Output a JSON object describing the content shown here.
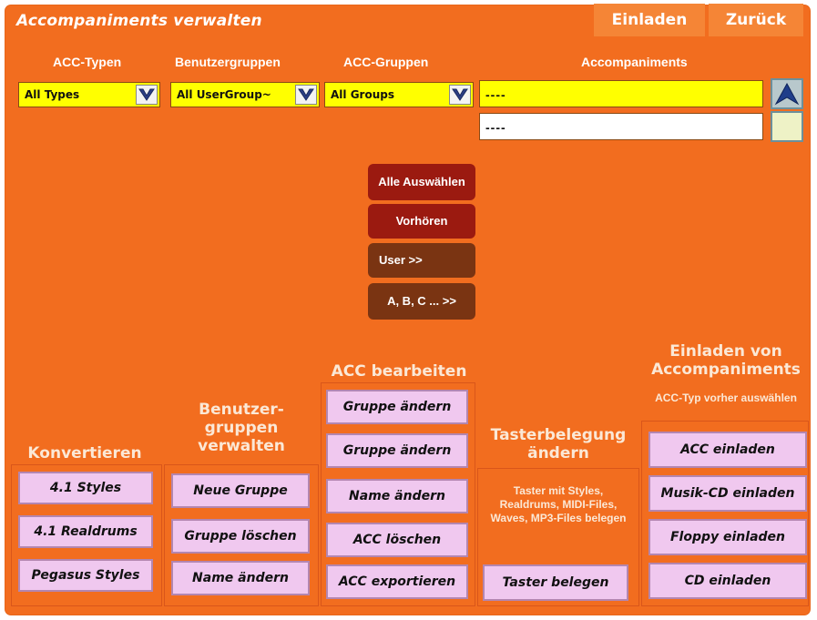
{
  "window": {
    "title": "Accompaniments verwalten",
    "load_label": "Einladen",
    "back_label": "Zurück"
  },
  "filters": {
    "types_header": "ACC-Typen",
    "usergroups_header": "Benutzergruppen",
    "groups_header": "ACC-Gruppen",
    "acc_header": "Accompaniments",
    "types_value": "All Types",
    "usergroups_value": "All UserGroup~",
    "groups_value": "All Groups",
    "acc_value_1": "----",
    "acc_value_2": "----"
  },
  "middle_buttons": {
    "select_all": "Alle Auswählen",
    "preview": "Vorhören",
    "user": "User  >>",
    "abc": "A, B, C ...  >>"
  },
  "convert": {
    "header": "Konvertieren",
    "buttons": [
      "4.1 Styles",
      "4.1 Realdrums",
      "Pegasus Styles"
    ]
  },
  "usergroups": {
    "header": "Benutzer-gruppen verwalten",
    "buttons": [
      "Neue Gruppe",
      "Gruppe löschen",
      "Name ändern"
    ]
  },
  "acc_edit": {
    "header": "ACC bearbeiten",
    "buttons": [
      "Gruppe ändern",
      "Gruppe ändern",
      "Name ändern",
      "ACC löschen",
      "ACC exportieren"
    ]
  },
  "keys": {
    "header": "Tasterbelegung ändern",
    "description": "Taster mit Styles, Realdrums, MIDI-Files, Waves, MP3-Files belegen",
    "button": "Taster belegen"
  },
  "load": {
    "header": "Einladen von Accompaniments",
    "note": "ACC-Typ vorher auswählen",
    "buttons": [
      "ACC einladen",
      "Musik-CD einladen",
      "Floppy einladen",
      "CD einladen"
    ]
  },
  "colors": {
    "background": "#f26d1f",
    "combo": "#ffff00",
    "button": "#f0c8ef",
    "dark_red": "#9b1a10",
    "dark_brown": "#7a3412"
  },
  "icons": {
    "dropdown": "chevron-down-icon",
    "scroll_up": "arrow-up-icon"
  }
}
